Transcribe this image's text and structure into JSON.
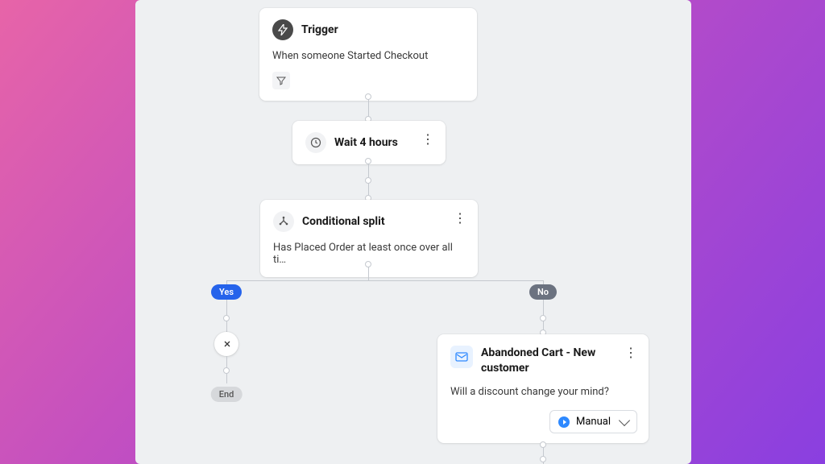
{
  "trigger": {
    "title": "Trigger",
    "description": "When someone Started Checkout"
  },
  "wait": {
    "title": "Wait 4 hours"
  },
  "split": {
    "title": "Conditional split",
    "description": "Has Placed Order at least once over all ti…",
    "yes_label": "Yes",
    "no_label": "No"
  },
  "yes_branch": {
    "end_label": "End"
  },
  "email": {
    "title": "Abandoned Cart - New customer",
    "description": "Will a discount change your mind?",
    "status_label": "Manual"
  }
}
